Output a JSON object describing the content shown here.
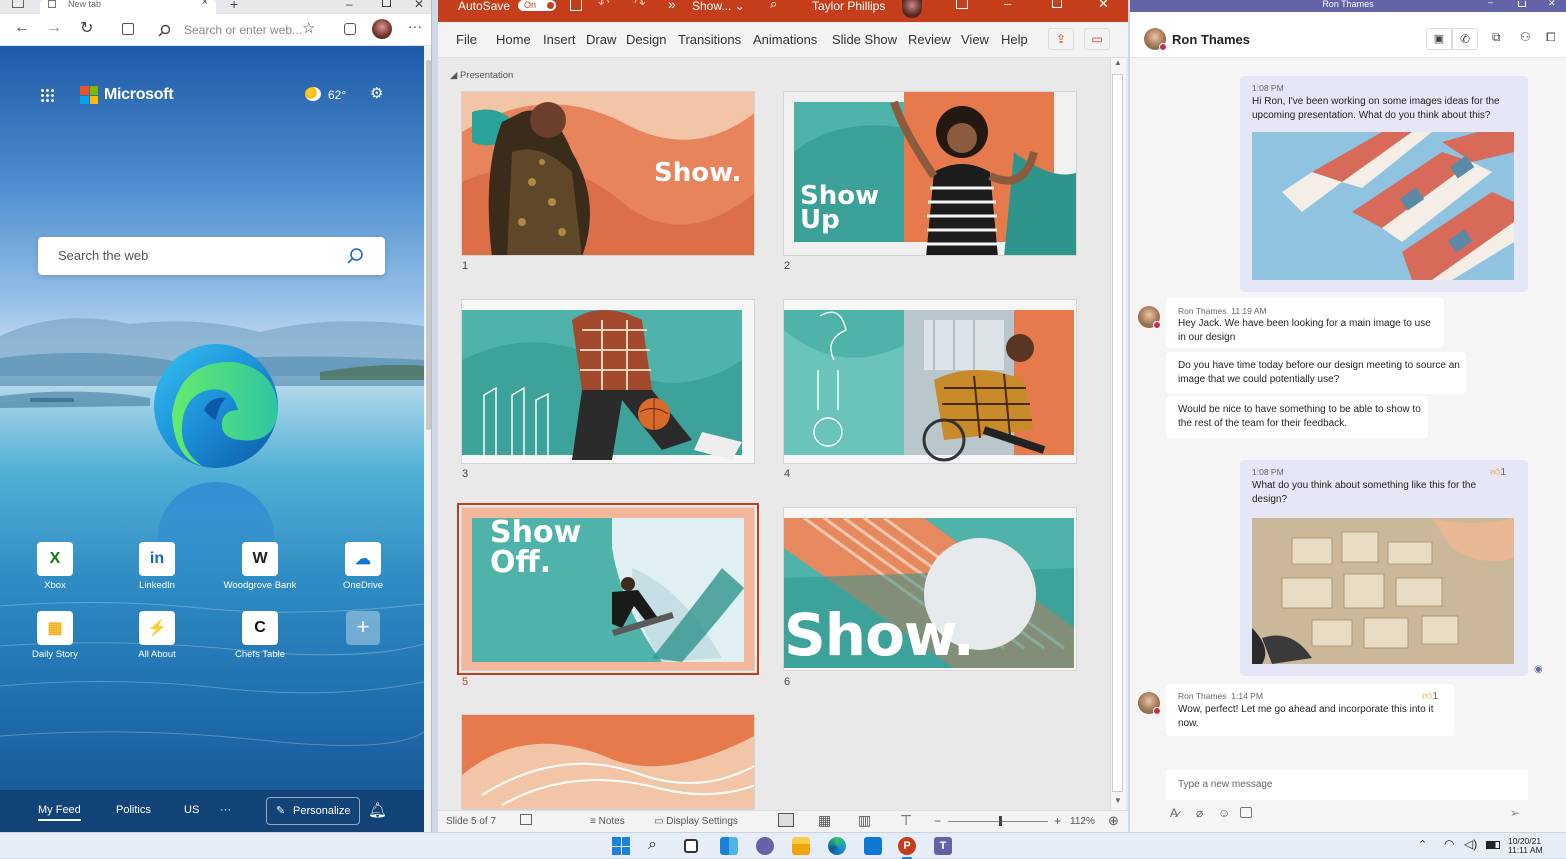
{
  "edge": {
    "tab_title": "New tab",
    "address_placeholder": "Search or enter web...",
    "brand": "Microsoft",
    "weather": "62°",
    "search_placeholder": "Search the web",
    "tiles": [
      {
        "label": "Xbox",
        "glyph": "X",
        "color": "#107c10"
      },
      {
        "label": "LinkedIn",
        "glyph": "in",
        "color": "#0a66c2"
      },
      {
        "label": "Woodgrove Bank",
        "glyph": "W",
        "color": "#222222"
      },
      {
        "label": "OneDrive",
        "glyph": "☁",
        "color": "#0f78d4"
      },
      {
        "label": "Daily Story",
        "glyph": "▦",
        "color": "#f3b11b"
      },
      {
        "label": "All About",
        "glyph": "⚡",
        "color": "#f08a00"
      },
      {
        "label": "Chefs Table",
        "glyph": "C",
        "color": "#111111"
      }
    ],
    "feed": {
      "my_feed": "My Feed",
      "politics": "Politics",
      "us": "US",
      "more": "···",
      "personalize": "Personalize"
    }
  },
  "ppt": {
    "autosave_label": "AutoSave",
    "autosave_state": "On",
    "more": "»",
    "file_name": "Show...",
    "user_name": "Taylor Phillips",
    "menu": [
      "File",
      "Home",
      "Insert",
      "Draw",
      "Design",
      "Transitions",
      "Animations",
      "Slide Show",
      "Review",
      "View",
      "Help"
    ],
    "section_label": "Presentation",
    "slides": [
      {
        "num": "1",
        "title": "Show."
      },
      {
        "num": "2",
        "title": "Show Up"
      },
      {
        "num": "3",
        "title": ""
      },
      {
        "num": "4",
        "title": ""
      },
      {
        "num": "5",
        "title": "Show Off."
      },
      {
        "num": "6",
        "title": "Show."
      }
    ],
    "selected_slide": "5",
    "status": {
      "slide_count": "Slide 5 of 7",
      "notes": "Notes",
      "display_settings": "Display Settings",
      "zoom": "112%",
      "zoom_minus": "−",
      "zoom_plus": "+"
    }
  },
  "teams": {
    "window_title": "Ron Thames",
    "contact": "Ron Thames",
    "messages": [
      {
        "time": "1:08 PM",
        "text": "Hi Ron, I've been working on some images ideas for the upcoming presentation. What do you think about this?"
      },
      {
        "sender": "Ron Thames",
        "time": "11:19 AM",
        "text": "Hey Jack. We have been looking for a main image to use in our design"
      },
      {
        "text": "Do you have time today before our design meeting to source an image that we could potentially use?"
      },
      {
        "text": "Would be nice to have something to be able to show to the rest of the team for their feedback."
      },
      {
        "time": "1:08 PM",
        "text": "What do you think about something like this for the design?",
        "reaction": "1"
      },
      {
        "sender": "Ron Thames",
        "time": "1:14 PM",
        "text": "Wow, perfect! Let me go ahead and incorporate this into it now.",
        "reaction": "1"
      }
    ],
    "compose_placeholder": "Type a new message"
  },
  "taskbar": {
    "date": "10/20/21",
    "time": "11:11 AM"
  }
}
